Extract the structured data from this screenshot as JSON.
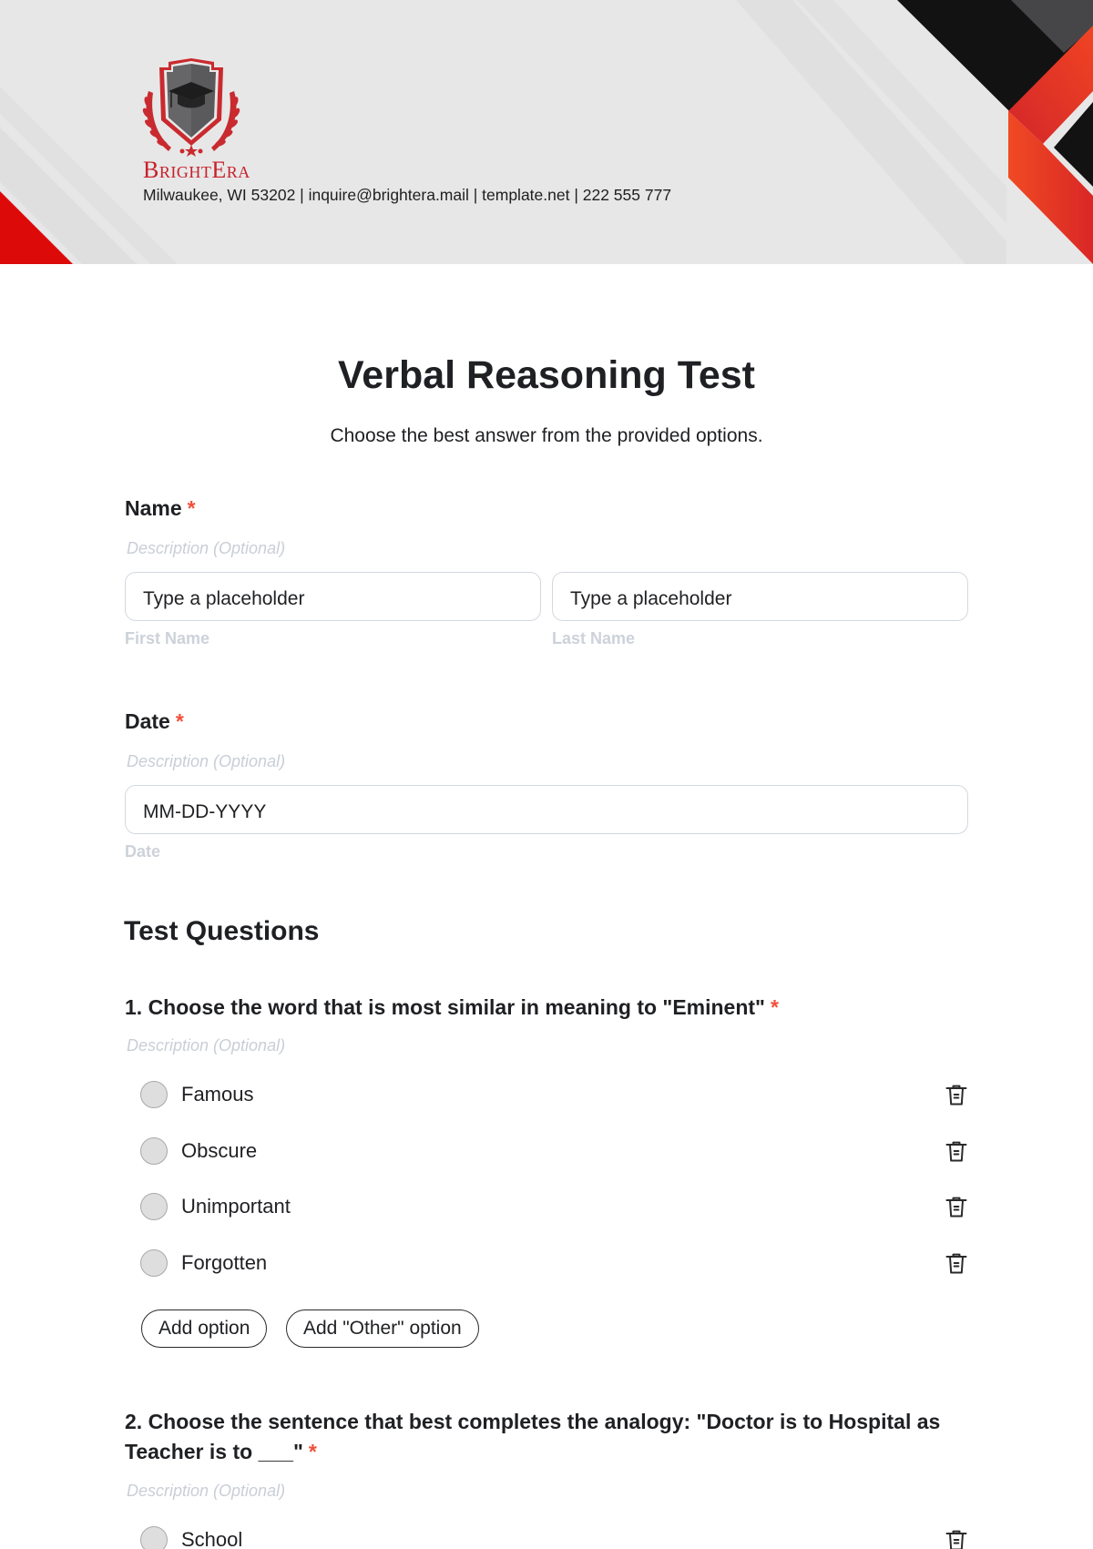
{
  "header": {
    "brand_name": "BrightEra",
    "contact_line": "Milwaukee, WI 53202 | inquire@brightera.mail | template.net | 222 555 777",
    "logo_icon": "graduation-shield-crest-icon",
    "colors": {
      "background": "#e7e7e7",
      "red": "#dd0a0a",
      "orange": "#ee4423",
      "black": "#121212",
      "brand_text": "#c8202a"
    }
  },
  "form": {
    "title": "Verbal Reasoning Test",
    "subtitle": "Choose the best answer from the provided options.",
    "required_marker": "*",
    "fields": [
      {
        "label": "Name",
        "required": true,
        "description_placeholder": "Description (Optional)",
        "inputs": [
          {
            "value": "Type a placeholder",
            "sublabel": "First Name"
          },
          {
            "value": "Type a placeholder",
            "sublabel": "Last Name"
          }
        ]
      },
      {
        "label": "Date",
        "required": true,
        "description_placeholder": "Description (Optional)",
        "inputs": [
          {
            "value": "MM-DD-YYYY",
            "sublabel": "Date"
          }
        ]
      }
    ],
    "section_title": "Test Questions",
    "questions": [
      {
        "text": "1. Choose the word that is most similar in meaning to \"Eminent\"",
        "required": true,
        "description_placeholder": "Description (Optional)",
        "options": [
          "Famous",
          "Obscure",
          "Unimportant",
          "Forgotten"
        ],
        "add_option_label": "Add option",
        "add_other_label": "Add \"Other\" option"
      },
      {
        "text": "2. Choose the sentence that best completes the analogy: \"Doctor is to Hospital as Teacher is to ___\"",
        "required": true,
        "description_placeholder": "Description (Optional)",
        "options": [
          "School"
        ]
      }
    ],
    "colors": {
      "required": "#f0503a",
      "muted": "#c9ced6",
      "border": "#d3d8e0",
      "text": "#1f2023"
    }
  }
}
